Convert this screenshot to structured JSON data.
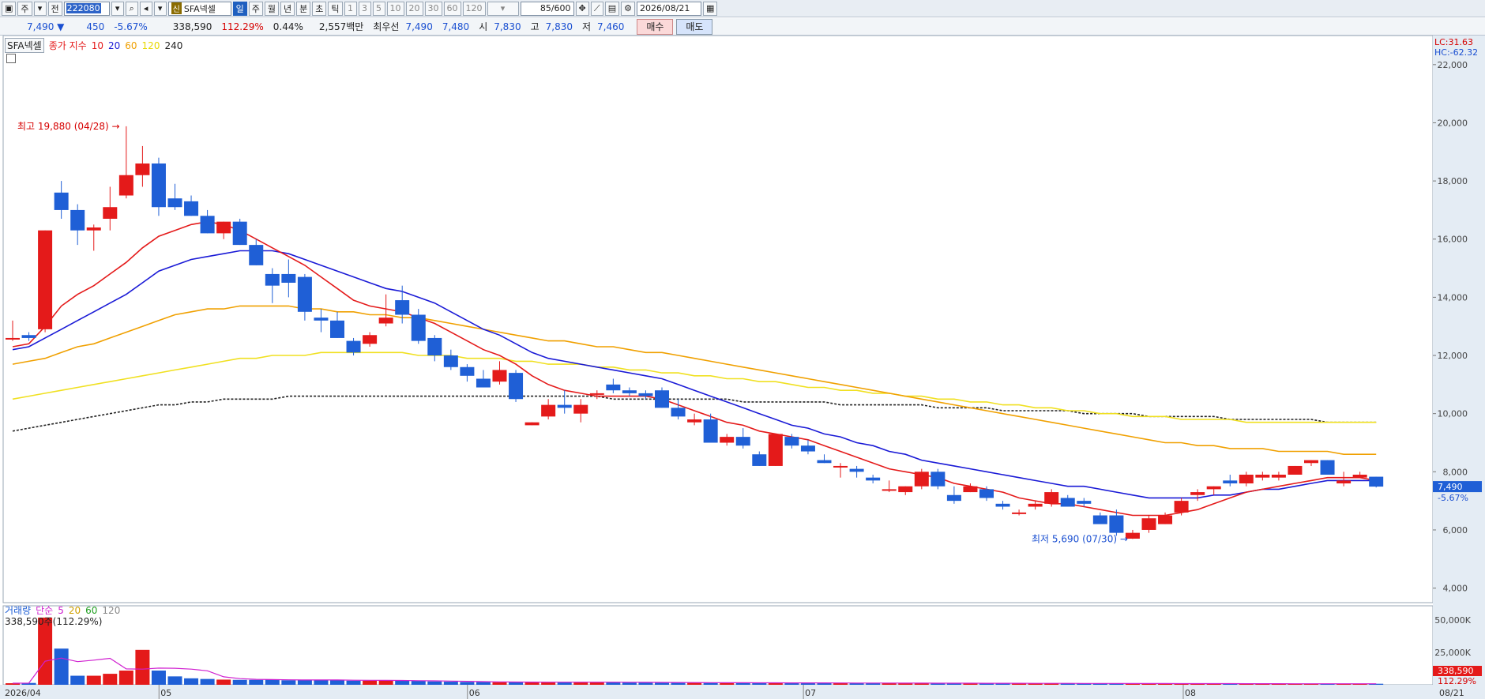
{
  "toolbar": {
    "period_label": "주",
    "range_label": "전",
    "code": "222080",
    "badge": "신",
    "stock_name": "SFA넥셀",
    "periods": [
      "일",
      "주",
      "월",
      "년",
      "분",
      "초",
      "틱"
    ],
    "intervals": [
      "1",
      "3",
      "5",
      "10",
      "20",
      "30",
      "60",
      "120"
    ],
    "count": "85/600",
    "date": "2026/08/21"
  },
  "quote": {
    "price": "7,490 ▼",
    "change": "450",
    "change_pct": "-5.67%",
    "volume": "338,590",
    "volume_pct": "112.29%",
    "turnover": "0.44%",
    "amount": "2,557백만",
    "best_label": "최우선",
    "best_ask": "7,490",
    "best_bid": "7,480",
    "open_label": "시",
    "open": "7,830",
    "high_label": "고",
    "high": "7,830",
    "low_label": "저",
    "low": "7,460",
    "buy_label": "매수",
    "sell_label": "매도"
  },
  "legend": {
    "name": "SFA넥셀",
    "series_label": "종가 지수",
    "ma": [
      "10",
      "20",
      "60",
      "120",
      "240"
    ]
  },
  "volume_legend": {
    "title": "거래량",
    "ma_label": "단순",
    "ma": [
      "5",
      "20",
      "60",
      "120"
    ],
    "current": "338,590주(112.29%)"
  },
  "axis": {
    "price_ticks": [
      "22,000",
      "20,000",
      "18,000",
      "16,000",
      "14,000",
      "12,000",
      "10,000",
      "8,000",
      "6,000",
      "4,000"
    ],
    "volume_ticks": [
      "50,000K",
      "25,000K"
    ],
    "x_labels": [
      "2026/04",
      "05",
      "06",
      "07",
      "08",
      "08/21"
    ],
    "lc": "LC:31.63",
    "hc": "HC:-62.32",
    "last_price": "7,490",
    "last_pct": "-5.67%",
    "last_volume": "338,590",
    "last_volume_pct": "112.29%"
  },
  "annotations": {
    "high": "최고 19,880 (04/28)",
    "low": "최저 5,690 (07/30)"
  },
  "colors": {
    "up": "#e41a1a",
    "down": "#1f5fd6",
    "ma10": "#e41a1a",
    "ma20": "#1a1ad6",
    "ma60": "#f0a000",
    "ma120": "#f0e020",
    "ma240": "#222222"
  },
  "chart_data": {
    "type": "candlestick",
    "ylim": [
      3500,
      23000
    ],
    "candles": [
      [
        12600,
        13200,
        12500,
        12600
      ],
      [
        12700,
        12800,
        12500,
        12600
      ],
      [
        12900,
        16300,
        12800,
        16300
      ],
      [
        17600,
        18000,
        16700,
        17000
      ],
      [
        17000,
        17200,
        15800,
        16300
      ],
      [
        16300,
        16500,
        15600,
        16400
      ],
      [
        16700,
        17800,
        16300,
        17100
      ],
      [
        17500,
        19880,
        17400,
        18200
      ],
      [
        18200,
        19200,
        17800,
        18600
      ],
      [
        18600,
        18800,
        16800,
        17100
      ],
      [
        17400,
        17900,
        17000,
        17100
      ],
      [
        17300,
        17500,
        16800,
        16800
      ],
      [
        16800,
        17000,
        16200,
        16200
      ],
      [
        16200,
        16600,
        16000,
        16600
      ],
      [
        16600,
        16700,
        15800,
        15800
      ],
      [
        15800,
        16000,
        15100,
        15100
      ],
      [
        14800,
        15000,
        13800,
        14400
      ],
      [
        14800,
        15300,
        14000,
        14500
      ],
      [
        14700,
        14800,
        13200,
        13500
      ],
      [
        13300,
        13600,
        12800,
        13200
      ],
      [
        13200,
        13500,
        12600,
        12600
      ],
      [
        12500,
        12600,
        12000,
        12100
      ],
      [
        12400,
        12800,
        12300,
        12700
      ],
      [
        13100,
        14100,
        13000,
        13300
      ],
      [
        13900,
        14400,
        13100,
        13400
      ],
      [
        13400,
        13600,
        12400,
        12500
      ],
      [
        12600,
        12700,
        11800,
        12000
      ],
      [
        12000,
        12200,
        11500,
        11600
      ],
      [
        11600,
        11700,
        11100,
        11300
      ],
      [
        11200,
        11500,
        10900,
        10900
      ],
      [
        11100,
        11800,
        11000,
        11500
      ],
      [
        11400,
        11500,
        10400,
        10500
      ],
      [
        9600,
        9700,
        9600,
        9700
      ],
      [
        9900,
        10500,
        9800,
        10300
      ],
      [
        10300,
        10800,
        10000,
        10200
      ],
      [
        10000,
        10500,
        9700,
        10300
      ],
      [
        10700,
        10800,
        10500,
        10700
      ],
      [
        11000,
        11200,
        10700,
        10800
      ],
      [
        10800,
        10900,
        10600,
        10700
      ],
      [
        10700,
        10800,
        10500,
        10600
      ],
      [
        10800,
        10900,
        10200,
        10200
      ],
      [
        10200,
        10500,
        9800,
        9900
      ],
      [
        9700,
        10000,
        9600,
        9800
      ],
      [
        9800,
        10000,
        9000,
        9000
      ],
      [
        9000,
        9300,
        8900,
        9200
      ],
      [
        9200,
        9500,
        8800,
        8900
      ],
      [
        8600,
        8700,
        8200,
        8200
      ],
      [
        8200,
        9300,
        8200,
        9300
      ],
      [
        9200,
        9300,
        8800,
        8900
      ],
      [
        8900,
        9100,
        8600,
        8700
      ],
      [
        8400,
        8600,
        8300,
        8300
      ],
      [
        8200,
        8300,
        7800,
        8200
      ],
      [
        8100,
        8200,
        7800,
        8000
      ],
      [
        7800,
        7900,
        7600,
        7700
      ],
      [
        7400,
        7700,
        7300,
        7400
      ],
      [
        7300,
        7500,
        7200,
        7500
      ],
      [
        7500,
        8100,
        7400,
        8000
      ],
      [
        8000,
        8100,
        7400,
        7500
      ],
      [
        7200,
        7500,
        6900,
        7000
      ],
      [
        7300,
        7600,
        7300,
        7500
      ],
      [
        7400,
        7500,
        7000,
        7100
      ],
      [
        6900,
        7000,
        6700,
        6800
      ],
      [
        6600,
        6700,
        6500,
        6600
      ],
      [
        6800,
        7000,
        6700,
        6900
      ],
      [
        6900,
        7400,
        6800,
        7300
      ],
      [
        7100,
        7200,
        6800,
        6800
      ],
      [
        7000,
        7100,
        6800,
        6900
      ],
      [
        6500,
        6600,
        6400,
        6200
      ],
      [
        6500,
        6700,
        5800,
        5900
      ],
      [
        5700,
        6000,
        5690,
        5900
      ],
      [
        6000,
        6500,
        5900,
        6400
      ],
      [
        6200,
        6600,
        6200,
        6500
      ],
      [
        6600,
        7100,
        6500,
        7000
      ],
      [
        7200,
        7400,
        7000,
        7300
      ],
      [
        7400,
        7500,
        7200,
        7500
      ],
      [
        7700,
        7900,
        7500,
        7600
      ],
      [
        7600,
        8000,
        7500,
        7900
      ],
      [
        7800,
        8000,
        7700,
        7900
      ],
      [
        7800,
        8000,
        7700,
        7900
      ],
      [
        7900,
        8200,
        7900,
        8200
      ],
      [
        8300,
        8400,
        8200,
        8400
      ],
      [
        8400,
        8400,
        7900,
        7900
      ],
      [
        7600,
        8000,
        7500,
        7700
      ],
      [
        7800,
        8000,
        7800,
        7900
      ],
      [
        7830,
        7830,
        7460,
        7490
      ]
    ],
    "ma10": [
      12300,
      12400,
      13000,
      13700,
      14100,
      14400,
      14800,
      15200,
      15700,
      16100,
      16300,
      16500,
      16600,
      16500,
      16300,
      16000,
      15700,
      15400,
      15100,
      14700,
      14300,
      13900,
      13700,
      13600,
      13500,
      13300,
      13100,
      12800,
      12500,
      12200,
      12000,
      11700,
      11300,
      11000,
      10800,
      10700,
      10600,
      10600,
      10600,
      10600,
      10500,
      10300,
      10100,
      9900,
      9700,
      9600,
      9400,
      9300,
      9200,
      9100,
      8900,
      8700,
      8500,
      8300,
      8100,
      8000,
      7900,
      7800,
      7600,
      7500,
      7400,
      7300,
      7100,
      7000,
      6900,
      6900,
      6800,
      6700,
      6600,
      6500,
      6500,
      6500,
      6600,
      6700,
      6900,
      7100,
      7300,
      7400,
      7500,
      7600,
      7700,
      7800,
      7800,
      7800,
      7700
    ],
    "ma20": [
      12200,
      12300,
      12600,
      12900,
      13200,
      13500,
      13800,
      14100,
      14500,
      14900,
      15100,
      15300,
      15400,
      15500,
      15600,
      15600,
      15600,
      15500,
      15300,
      15100,
      14900,
      14700,
      14500,
      14300,
      14200,
      14000,
      13800,
      13500,
      13200,
      12900,
      12700,
      12400,
      12100,
      11900,
      11800,
      11700,
      11600,
      11500,
      11400,
      11300,
      11200,
      11000,
      10800,
      10600,
      10400,
      10200,
      10000,
      9800,
      9600,
      9500,
      9300,
      9200,
      9000,
      8900,
      8700,
      8600,
      8400,
      8300,
      8200,
      8100,
      8000,
      7900,
      7800,
      7700,
      7600,
      7500,
      7500,
      7400,
      7300,
      7200,
      7100,
      7100,
      7100,
      7100,
      7200,
      7200,
      7300,
      7400,
      7400,
      7500,
      7600,
      7700,
      7700,
      7700,
      7700
    ],
    "ma60": [
      11700,
      11800,
      11900,
      12100,
      12300,
      12400,
      12600,
      12800,
      13000,
      13200,
      13400,
      13500,
      13600,
      13600,
      13700,
      13700,
      13700,
      13700,
      13600,
      13600,
      13500,
      13500,
      13400,
      13400,
      13300,
      13300,
      13200,
      13100,
      13000,
      12900,
      12800,
      12700,
      12600,
      12500,
      12500,
      12400,
      12300,
      12300,
      12200,
      12100,
      12100,
      12000,
      11900,
      11800,
      11700,
      11600,
      11500,
      11400,
      11300,
      11200,
      11100,
      11000,
      10900,
      10800,
      10700,
      10600,
      10500,
      10400,
      10300,
      10200,
      10100,
      10000,
      9900,
      9800,
      9700,
      9600,
      9500,
      9400,
      9300,
      9200,
      9100,
      9000,
      9000,
      8900,
      8900,
      8800,
      8800,
      8800,
      8700,
      8700,
      8700,
      8700,
      8600,
      8600,
      8600
    ],
    "ma120": [
      10500,
      10600,
      10700,
      10800,
      10900,
      11000,
      11100,
      11200,
      11300,
      11400,
      11500,
      11600,
      11700,
      11800,
      11900,
      11900,
      12000,
      12000,
      12000,
      12100,
      12100,
      12100,
      12100,
      12100,
      12100,
      12000,
      12000,
      12000,
      11900,
      11900,
      11900,
      11800,
      11800,
      11700,
      11700,
      11700,
      11600,
      11600,
      11500,
      11500,
      11400,
      11400,
      11300,
      11300,
      11200,
      11200,
      11100,
      11100,
      11000,
      10900,
      10900,
      10800,
      10800,
      10700,
      10700,
      10600,
      10600,
      10500,
      10500,
      10400,
      10400,
      10300,
      10300,
      10200,
      10200,
      10100,
      10100,
      10000,
      10000,
      9900,
      9900,
      9900,
      9800,
      9800,
      9800,
      9800,
      9700,
      9700,
      9700,
      9700,
      9700,
      9700,
      9700,
      9700,
      9700
    ],
    "ma240": [
      9400,
      9500,
      9600,
      9700,
      9800,
      9900,
      10000,
      10100,
      10200,
      10300,
      10300,
      10400,
      10400,
      10500,
      10500,
      10500,
      10500,
      10600,
      10600,
      10600,
      10600,
      10600,
      10600,
      10600,
      10600,
      10600,
      10600,
      10600,
      10600,
      10600,
      10600,
      10600,
      10600,
      10600,
      10600,
      10600,
      10600,
      10500,
      10500,
      10500,
      10500,
      10500,
      10500,
      10500,
      10500,
      10400,
      10400,
      10400,
      10400,
      10400,
      10400,
      10300,
      10300,
      10300,
      10300,
      10300,
      10300,
      10200,
      10200,
      10200,
      10200,
      10100,
      10100,
      10100,
      10100,
      10100,
      10000,
      10000,
      10000,
      10000,
      9900,
      9900,
      9900,
      9900,
      9900,
      9800,
      9800,
      9800,
      9800,
      9800,
      9800,
      9700,
      9700,
      9700,
      9700
    ],
    "volume": [
      1200,
      1400,
      52000,
      28000,
      7000,
      7000,
      8500,
      11000,
      27000,
      11000,
      6500,
      5000,
      4500,
      4000,
      3800,
      3800,
      4000,
      3500,
      3600,
      3600,
      3800,
      3200,
      3200,
      3300,
      3200,
      3000,
      2600,
      2400,
      2200,
      2100,
      2000,
      2000,
      2000,
      2100,
      2100,
      2000,
      1900,
      1900,
      1800,
      1800,
      1700,
      1600,
      1600,
      1600,
      1500,
      1500,
      1500,
      1500,
      1400,
      1400,
      1400,
      1300,
      1300,
      1300,
      1300,
      1200,
      1200,
      1200,
      1200,
      1200,
      1100,
      1100,
      1100,
      1100,
      1100,
      1000,
      1000,
      1000,
      1000,
      1000,
      900,
      900,
      900,
      900,
      900,
      900,
      800,
      800,
      800,
      800,
      800,
      800,
      800,
      800,
      800
    ],
    "volume_ylim": [
      0,
      55000
    ]
  }
}
